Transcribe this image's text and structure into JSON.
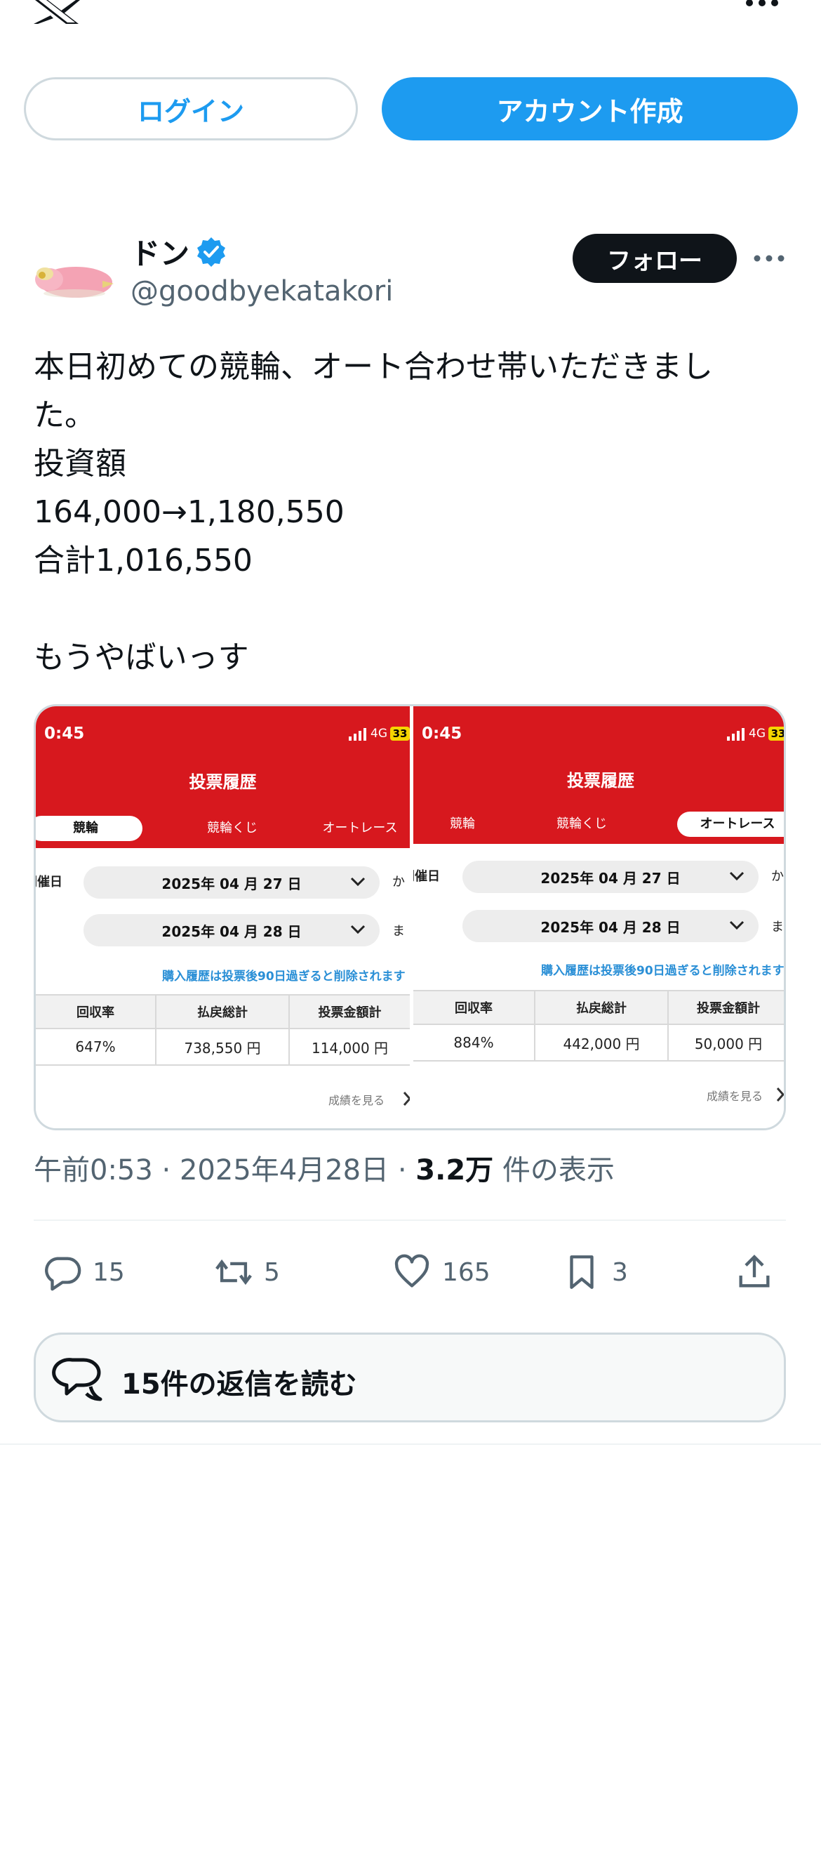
{
  "header": {
    "logo_icon": "x-logo-icon",
    "more_icon": "more-icon"
  },
  "auth": {
    "login_label": "ログイン",
    "signup_label": "アカウント作成"
  },
  "author": {
    "display_name": "ドン",
    "handle": "@goodbyekatakori",
    "verified_icon": "verified-badge-icon",
    "follow_label": "フォロー"
  },
  "tweet": {
    "lines": [
      "本日初めての競輪、オート合わせ帯いただきまし",
      "た。",
      "投資額",
      "164,000→1,180,550",
      "合計1,016,550",
      "",
      "もうやばいっす"
    ]
  },
  "media": {
    "left": {
      "clock": "0:45",
      "network": "4G",
      "battery": "33",
      "title": "投票履歴",
      "tabs": [
        "競輪",
        "競輪くじ",
        "オートレース"
      ],
      "selected_tab": 0,
      "date_label": "開催日",
      "date_from": "2025年 04 月 27 日",
      "date_to": "2025年 04 月 28 日",
      "date_from_suffix": "か",
      "date_to_suffix": "ま",
      "notice": "購入履歴は投票後90日過ぎると削除されます",
      "headers": [
        "回収率",
        "払戻総計",
        "投票金額計"
      ],
      "values": [
        "647%",
        "738,550 円",
        "114,000 円"
      ],
      "results_link": "成績を見る"
    },
    "right": {
      "clock": "0:45",
      "network": "4G",
      "battery": "33",
      "title": "投票履歴",
      "tabs": [
        "競輪",
        "競輪くじ",
        "オートレース"
      ],
      "selected_tab": 2,
      "date_label": "開催日",
      "date_from": "2025年 04 月 27 日",
      "date_to": "2025年 04 月 28 日",
      "date_from_suffix": "か",
      "date_to_suffix": "ま",
      "notice": "購入履歴は投票後90日過ぎると削除されます",
      "headers": [
        "回収率",
        "払戻総計",
        "投票金額計"
      ],
      "values": [
        "884%",
        "442,000 円",
        "50,000 円"
      ],
      "results_link": "成績を見る"
    }
  },
  "meta": {
    "time": "午前0:53",
    "date": "2025年4月28日",
    "views": "3.2万",
    "views_label": "件の表示",
    "separator": "·"
  },
  "actions": {
    "replies": "15",
    "reposts": "5",
    "likes": "165",
    "bookmarks": "3"
  },
  "read_replies_label": "15件の返信を読む",
  "colors": {
    "accent": "#1d9bf0",
    "text": "#0f1419",
    "muted": "#536471",
    "app_red": "#d7181e"
  }
}
